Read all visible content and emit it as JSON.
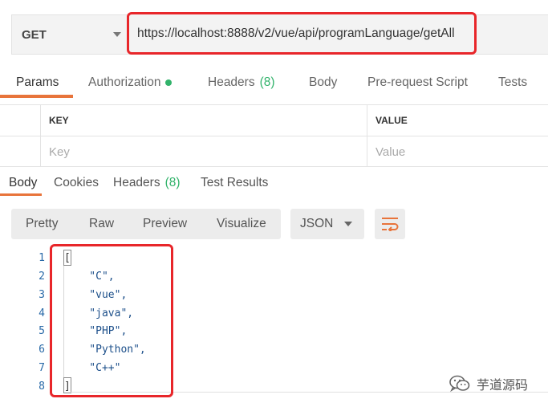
{
  "request": {
    "method": "GET",
    "url": "https://localhost:8888/v2/vue/api/programLanguage/getAll"
  },
  "request_tabs": [
    {
      "label": "Params"
    },
    {
      "label": "Authorization"
    },
    {
      "label": "Headers",
      "count": "(8)"
    },
    {
      "label": "Body"
    },
    {
      "label": "Pre-request Script"
    },
    {
      "label": "Tests"
    }
  ],
  "params_table": {
    "headers": [
      "KEY",
      "VALUE"
    ],
    "placeholders": {
      "key": "Key",
      "value": "Value"
    }
  },
  "response_tabs": [
    {
      "label": "Body"
    },
    {
      "label": "Cookies"
    },
    {
      "label": "Headers",
      "count": "(8)"
    },
    {
      "label": "Test Results"
    }
  ],
  "view_modes": [
    "Pretty",
    "Raw",
    "Preview",
    "Visualize"
  ],
  "format": "JSON",
  "response_body": {
    "line_numbers": [
      "1",
      "2",
      "3",
      "4",
      "5",
      "6",
      "7",
      "8"
    ],
    "lines": [
      "[",
      "    \"C\",",
      "    \"vue\",",
      "    \"java\",",
      "    \"PHP\",",
      "    \"Python\",",
      "    \"C++\"",
      "]"
    ]
  },
  "watermark": "芋道源码",
  "colors": {
    "accent": "#e8743b",
    "status_green": "#32b36b",
    "highlight_red": "#e8262a"
  }
}
